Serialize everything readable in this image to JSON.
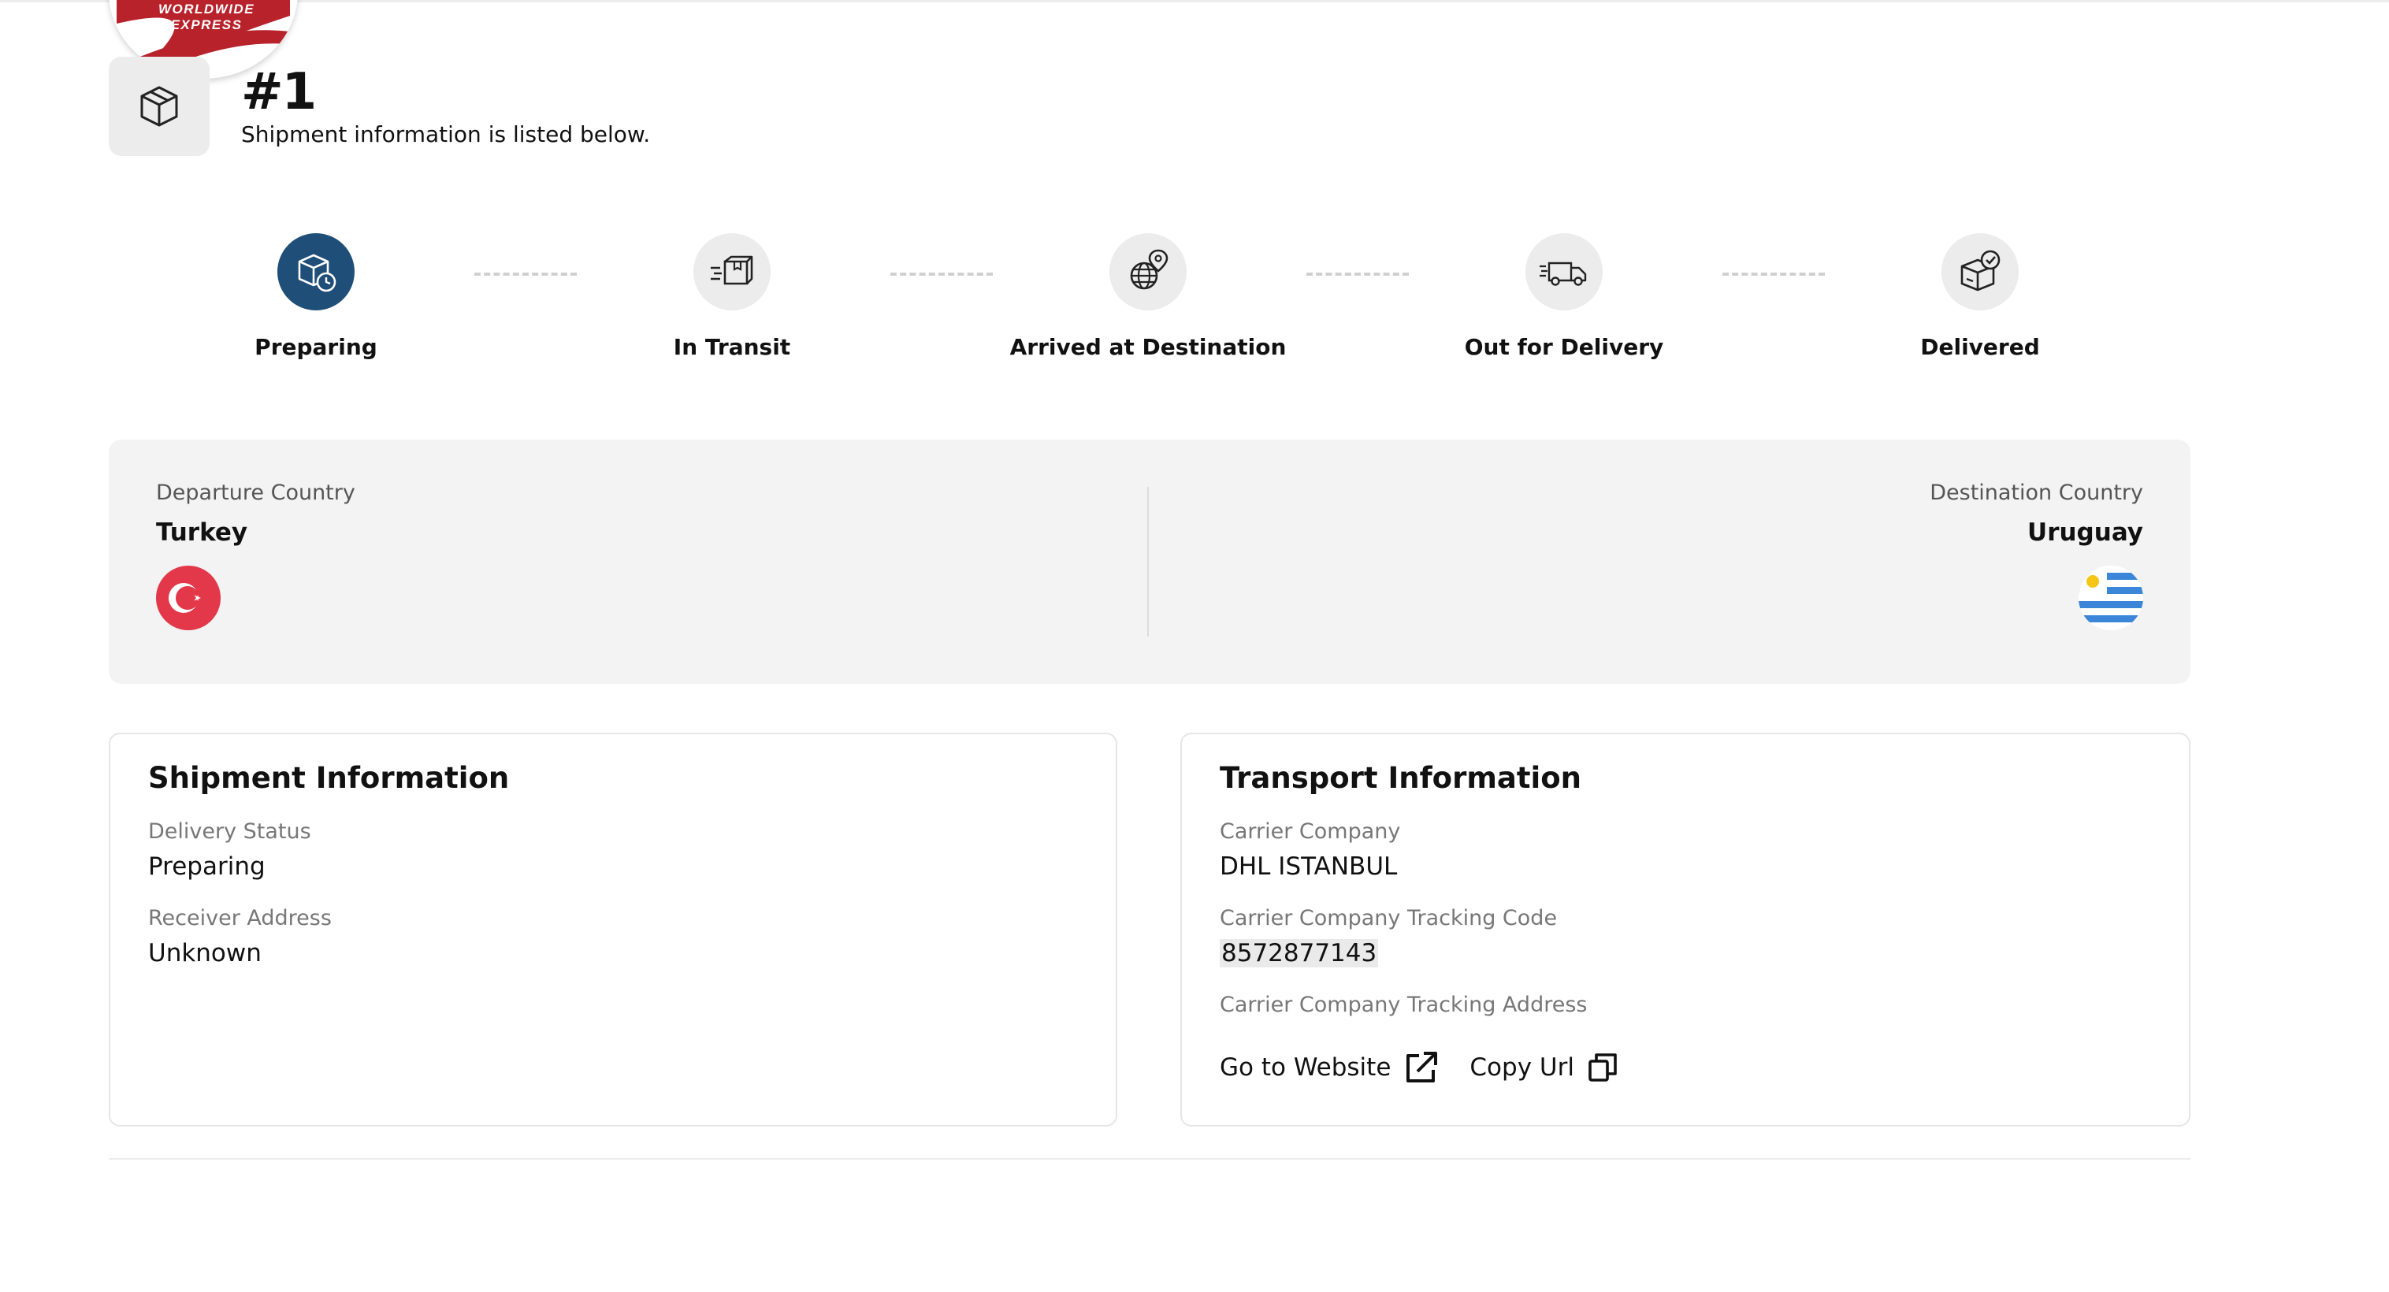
{
  "brand": {
    "logo_text": "WORLDWIDE EXPRESS",
    "accent": "#b8222a"
  },
  "shipment": {
    "number": "#1",
    "subtitle": "Shipment information is listed below."
  },
  "steps": [
    {
      "label": "Preparing",
      "icon": "package-clock-icon",
      "active": true
    },
    {
      "label": "In Transit",
      "icon": "moving-box-icon",
      "active": false
    },
    {
      "label": "Arrived at Destination",
      "icon": "globe-pin-icon",
      "active": false
    },
    {
      "label": "Out for Delivery",
      "icon": "delivery-truck-icon",
      "active": false
    },
    {
      "label": "Delivered",
      "icon": "box-check-icon",
      "active": false
    }
  ],
  "route": {
    "departure_label": "Departure Country",
    "departure_value": "Turkey",
    "departure_flag": "turkey-flag-icon",
    "destination_label": "Destination Country",
    "destination_value": "Uruguay",
    "destination_flag": "uruguay-flag-icon"
  },
  "shipment_info": {
    "title": "Shipment Information",
    "delivery_status_label": "Delivery Status",
    "delivery_status_value": "Preparing",
    "receiver_address_label": "Receiver Address",
    "receiver_address_value": "Unknown"
  },
  "transport_info": {
    "title": "Transport Information",
    "carrier_label": "Carrier Company",
    "carrier_value": "DHL ISTANBUL",
    "tracking_code_label": "Carrier Company Tracking Code",
    "tracking_code_value": "8572877143",
    "tracking_address_label": "Carrier Company Tracking Address",
    "go_to_website": "Go to Website",
    "copy_url": "Copy Url"
  },
  "colors": {
    "active_step": "#1f4e79",
    "panel_bg": "#f3f3f3",
    "turkey_red": "#e2384a",
    "uruguay_blue": "#3b86d9"
  }
}
